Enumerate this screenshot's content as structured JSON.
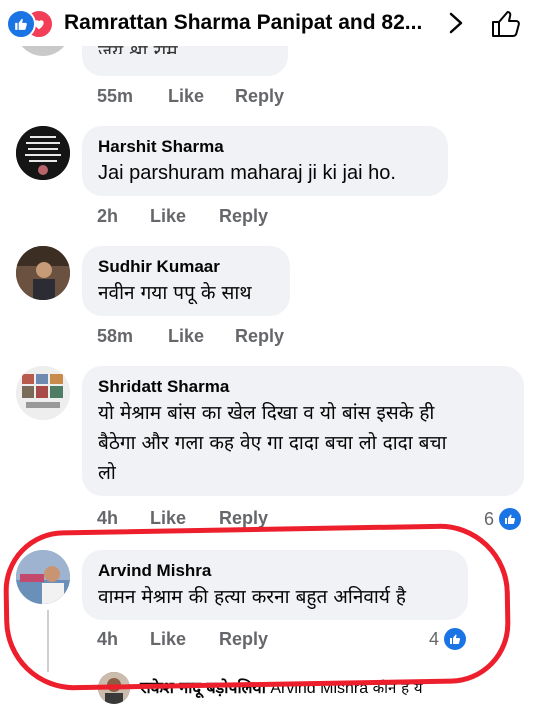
{
  "header": {
    "title": "Ramrattan Sharma Panipat and 82...",
    "icons": [
      "like-reaction-icon",
      "love-reaction-icon",
      "chevron-right-icon",
      "thumbs-up-icon"
    ]
  },
  "comments": [
    {
      "name": "",
      "text": "जय श्री राम",
      "time": "55m",
      "like": "Like",
      "reply": "Reply"
    },
    {
      "name": "Harshit Sharma",
      "text": "Jai parshuram maharaj ji ki jai ho.",
      "time": "2h",
      "like": "Like",
      "reply": "Reply"
    },
    {
      "name": "Sudhir Kumaar",
      "text": "नवीन गया पपू के साथ",
      "time": "58m",
      "like": "Like",
      "reply": "Reply"
    },
    {
      "name": "Shridatt Sharma",
      "text_lines": [
        "यो मेश्राम बांस का खेल दिखा व यो बांस इसके ही",
        "बैठेगा और गला कह वेए गा दादा बचा लो दादा बचा",
        "लो"
      ],
      "time": "4h",
      "like": "Like",
      "reply": "Reply",
      "reactions": "6"
    },
    {
      "name": "Arvind Mishra",
      "text": "वामन मेश्राम  की हत्या करना बहुत अनिवार्य है",
      "time": "4h",
      "like": "Like",
      "reply": "Reply",
      "reactions": "4"
    }
  ],
  "reply_preview": {
    "name": "राकेश नादू बड़ोपलिया",
    "mention": "Arvind Mishra",
    "text": "कौन है ये"
  },
  "colors": {
    "accent": "#1b74e4",
    "love": "#f33e58",
    "bubble": "#f0f2f5",
    "meta": "#65676b",
    "highlight": "#ee1f2c"
  }
}
